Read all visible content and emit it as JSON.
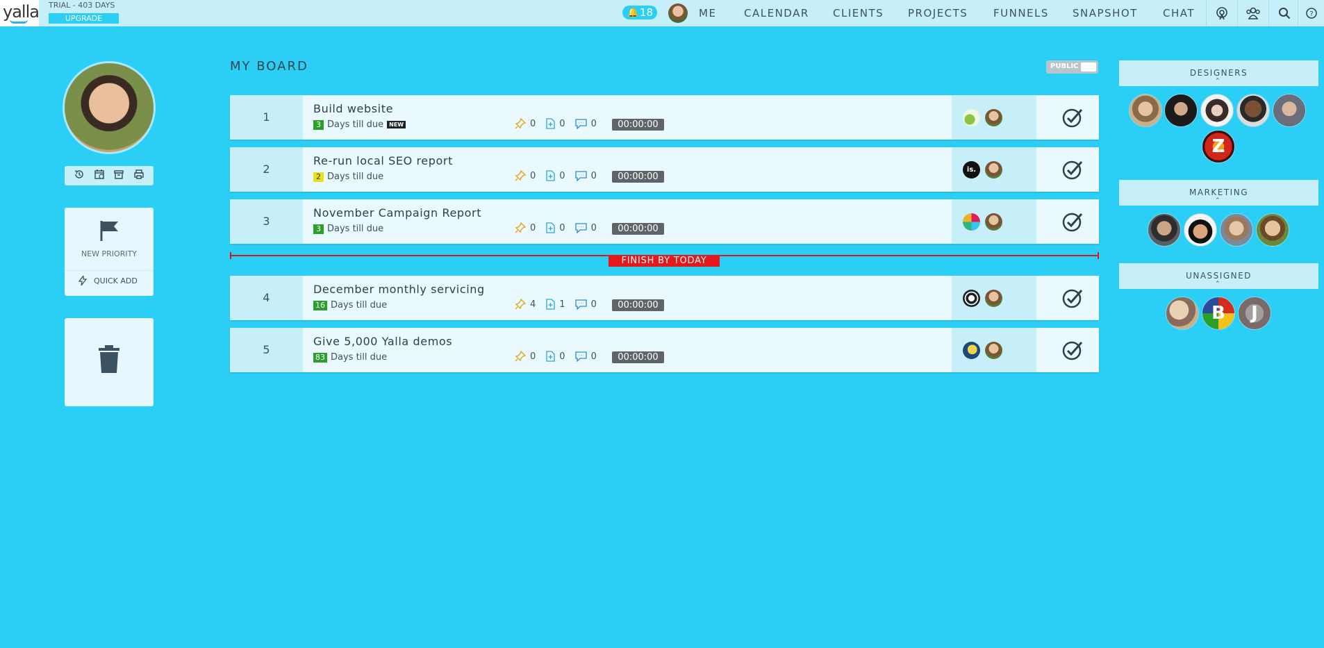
{
  "topbar": {
    "logo": "yalla",
    "trial": "TRIAL - 403 DAYS",
    "upgrade": "UPGRADE",
    "notifications": "18",
    "nav": [
      "ME",
      "CALENDAR",
      "CLIENTS",
      "PROJECTS",
      "FUNNELS",
      "SNAPSHOT",
      "CHAT"
    ],
    "icons": [
      "broadcast-icon",
      "team-icon",
      "search-icon",
      "help-icon"
    ]
  },
  "left": {
    "tools": [
      "history-icon",
      "schedule-icon",
      "archive-icon",
      "print-icon"
    ],
    "new_priority": "NEW PRIORITY",
    "quick_add": "QUICK ADD"
  },
  "board": {
    "title": "MY BOARD",
    "public_label": "PUBLIC",
    "finish_label": "FINISH BY TODAY",
    "due_text": "Days till due",
    "new_badge": "NEW",
    "tasks": [
      {
        "num": "1",
        "title": "Build website",
        "days": "3",
        "days_color": "#2aa02a",
        "pins": "0",
        "files": "0",
        "comments": "0",
        "timer": "00:00:00"
      },
      {
        "num": "2",
        "title": "Re-run local SEO report",
        "days": "2",
        "days_color": "#e8e21a",
        "pins": "0",
        "files": "0",
        "comments": "0",
        "timer": "00:00:00"
      },
      {
        "num": "3",
        "title": "November Campaign Report",
        "days": "3",
        "days_color": "#2aa02a",
        "pins": "0",
        "files": "0",
        "comments": "0",
        "timer": "00:00:00"
      },
      {
        "num": "4",
        "title": "December monthly servicing",
        "days": "16",
        "days_color": "#2aa02a",
        "pins": "4",
        "files": "1",
        "comments": "0",
        "timer": "00:00:00"
      },
      {
        "num": "5",
        "title": "Give 5,000 Yalla demos",
        "days": "83",
        "days_color": "#2aa02a",
        "pins": "0",
        "files": "0",
        "comments": "0",
        "timer": "00:00:00"
      }
    ]
  },
  "groups": {
    "designers": "DESIGNERS",
    "marketing": "MARKETING",
    "unassigned": "UNASSIGNED",
    "unassigned_letters": [
      "B",
      "J"
    ],
    "designer_letter": "Z",
    "client_logo_2": "is."
  }
}
